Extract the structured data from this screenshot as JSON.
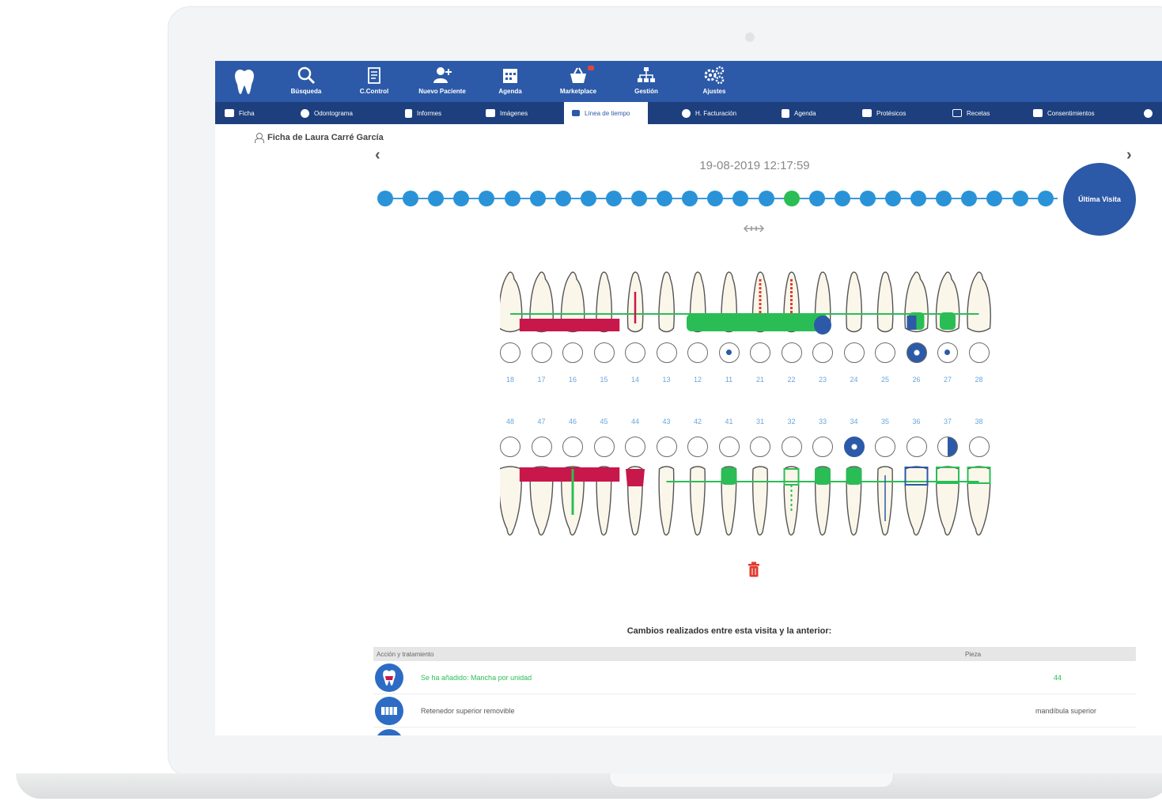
{
  "topnav": {
    "items": [
      {
        "label": "Búsqueda",
        "icon": "search-icon"
      },
      {
        "label": "C.Control",
        "icon": "clipboard-icon"
      },
      {
        "label": "Nuevo Paciente",
        "icon": "add-user-icon"
      },
      {
        "label": "Agenda",
        "icon": "calendar-icon"
      },
      {
        "label": "Marketplace",
        "icon": "basket-icon"
      },
      {
        "label": "Gestión",
        "icon": "org-chart-icon"
      },
      {
        "label": "Ajustes",
        "icon": "gears-icon"
      }
    ]
  },
  "subnav": {
    "tabs": [
      {
        "label": "Ficha"
      },
      {
        "label": "Odontograma"
      },
      {
        "label": "Informes"
      },
      {
        "label": "Imágenes"
      },
      {
        "label": "Línea de tiempo"
      },
      {
        "label": "H. Facturación"
      },
      {
        "label": "Agenda"
      },
      {
        "label": "Protésicos"
      },
      {
        "label": "Recetas"
      },
      {
        "label": "Consentimientos"
      }
    ],
    "active_index": 4
  },
  "patient": {
    "title": "Ficha de Laura Carré García"
  },
  "timeline": {
    "date": "19-08-2019 12:17:59",
    "dot_count": 27,
    "current_index": 16,
    "last_visit_label": "Última Visita",
    "colors": {
      "dot": "#2a93d8",
      "current": "#2bbd55",
      "last": "#2c5aa8"
    }
  },
  "odontogram": {
    "upper_numbers": [
      "18",
      "17",
      "16",
      "15",
      "14",
      "13",
      "12",
      "11",
      "21",
      "22",
      "23",
      "24",
      "25",
      "26",
      "27",
      "28"
    ],
    "lower_numbers": [
      "48",
      "47",
      "46",
      "45",
      "44",
      "43",
      "42",
      "41",
      "31",
      "32",
      "33",
      "34",
      "35",
      "36",
      "37",
      "38"
    ],
    "colors": {
      "red": "#c8174a",
      "green": "#2bbd55",
      "blue": "#2c5aa8"
    }
  },
  "changes": {
    "title": "Cambios realizados entre esta visita y la anterior:",
    "columns": {
      "action": "Acción y tratamiento",
      "piece": "Pieza"
    },
    "rows": [
      {
        "action": "Se ha añadido: Mancha por unidad",
        "piece": "44",
        "style": "green"
      },
      {
        "action": "Retenedor superior removible",
        "piece": "mandíbula superior",
        "style": "gray"
      }
    ]
  }
}
